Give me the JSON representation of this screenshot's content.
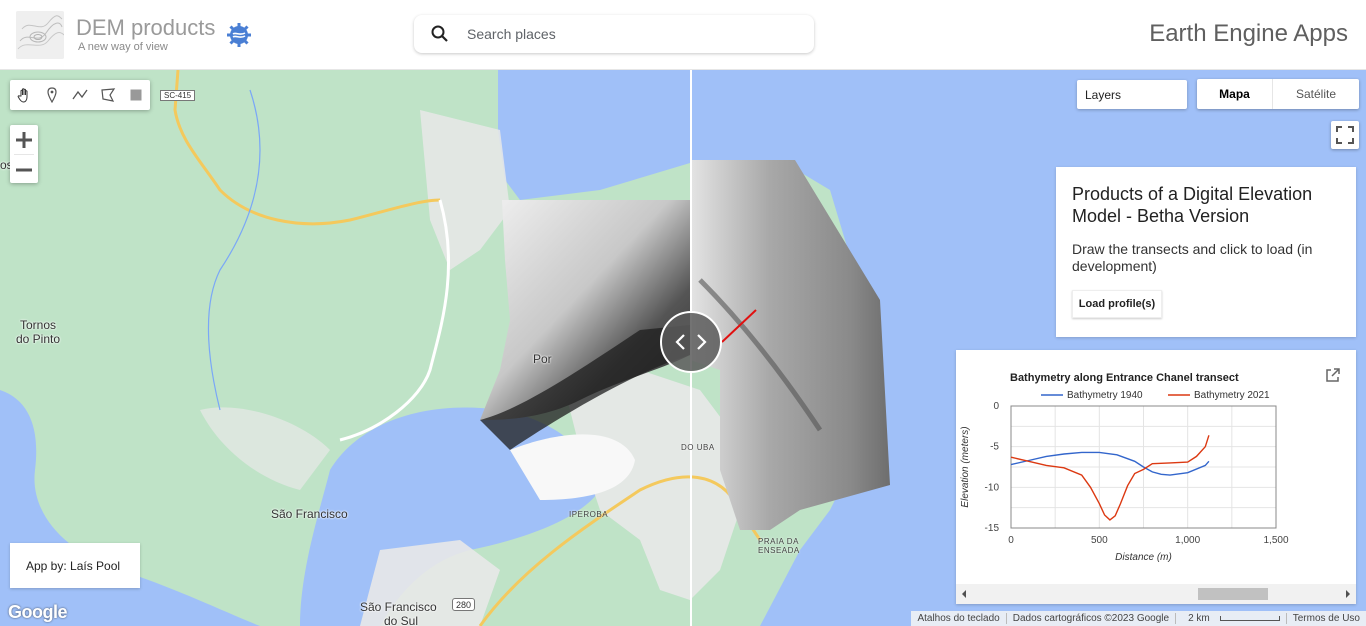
{
  "header": {
    "brand_title": "DEM products",
    "brand_subtitle": "A new way of view",
    "search_placeholder": "Search places",
    "app_title": "Earth Engine Apps"
  },
  "map": {
    "layers_label": "Layers",
    "maptype_map": "Mapa",
    "maptype_satellite": "Satélite",
    "road_shield": "SC-415",
    "road_shield_280": "280",
    "place_labels": {
      "tornos": "Tornos",
      "do_pinto": "do Pinto",
      "sao_francisco": "São Francisco",
      "sao_francisco_sul_1": "São Francisco",
      "sao_francisco_sul_2": "do Sul",
      "iperoba": "IPEROBA",
      "do_uba": "DO UBA",
      "praia_1": "PRAIA DA",
      "praia_2": "ENSEADA",
      "por": "Por",
      "os": "os"
    },
    "credit": "App by: Laís Pool",
    "google_logo": "Google",
    "attribution": {
      "shortcuts": "Atalhos do teclado",
      "data": "Dados cartográficos ©2023 Google",
      "scale": "2 km",
      "terms": "Termos de Uso"
    },
    "colors": {
      "water": "#a0c0f8",
      "land": "#bfe3c7",
      "urban": "#e8e8e8",
      "road": "#f4c95d",
      "transect": "#e11010"
    }
  },
  "info_panel": {
    "title": "Products of a Digital Elevation Model - Betha Version",
    "description": "Draw the transects and click to load (in development)",
    "load_button": "Load profile(s)"
  },
  "chart_data": {
    "type": "line",
    "title": "Bathymetry along Entrance Chanel transect",
    "xlabel": "Distance (m)",
    "ylabel": "Elevation (meters)",
    "xlim": [
      0,
      1500
    ],
    "ylim": [
      -15,
      0
    ],
    "xticks": [
      "0",
      "500",
      "1,000",
      "1,500"
    ],
    "yticks": [
      "0",
      "-5",
      "-10",
      "-15"
    ],
    "legend": "top",
    "grid": true,
    "series": [
      {
        "name": "Bathymetry 1940",
        "color": "#3366cc",
        "x": [
          0,
          100,
          200,
          300,
          400,
          500,
          600,
          700,
          750,
          800,
          850,
          900,
          1000,
          1100,
          1120
        ],
        "y": [
          -7.2,
          -6.7,
          -6.2,
          -5.9,
          -5.7,
          -5.7,
          -6.0,
          -6.8,
          -7.5,
          -8.1,
          -8.4,
          -8.5,
          -8.2,
          -7.3,
          -6.8
        ]
      },
      {
        "name": "Bathymetry 2021",
        "color": "#dc3912",
        "x": [
          0,
          100,
          200,
          300,
          400,
          450,
          500,
          530,
          560,
          590,
          620,
          660,
          700,
          750,
          800,
          900,
          1000,
          1050,
          1100,
          1120
        ],
        "y": [
          -6.3,
          -6.8,
          -7.3,
          -7.6,
          -8.5,
          -10.0,
          -12.0,
          -13.4,
          -14.0,
          -13.5,
          -12.0,
          -9.8,
          -8.3,
          -7.8,
          -7.1,
          -7.0,
          -6.9,
          -6.2,
          -5.0,
          -3.6
        ]
      }
    ]
  }
}
